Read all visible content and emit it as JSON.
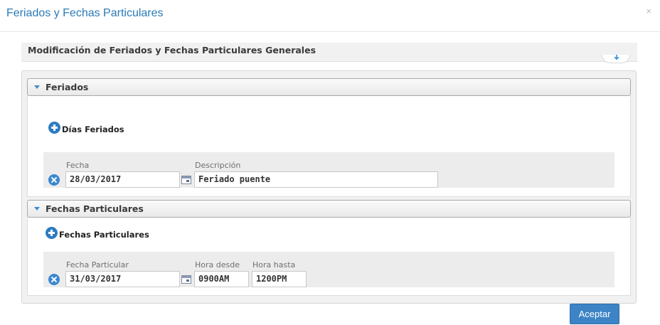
{
  "modal": {
    "title": "Feriados y Fechas Particulares",
    "close_glyph": "×"
  },
  "general": {
    "title": "Modificación de  Feriados y Fechas Particulares Generales"
  },
  "feriados": {
    "section_title": "Feriados",
    "add_label": "Días Feriados",
    "fields": {
      "date_label": "Fecha",
      "description_label": "Descripción"
    },
    "rows": [
      {
        "date": "28/03/2017",
        "description": "Feriado puente"
      }
    ]
  },
  "particulares": {
    "section_title": "Fechas Particulares",
    "add_label": "Fechas Particulares",
    "fields": {
      "date_label": "Fecha Particular",
      "from_label": "Hora desde",
      "to_label": "Hora hasta"
    },
    "rows": [
      {
        "date": "31/03/2017",
        "from": "0900AM",
        "to": "1200PM"
      }
    ]
  },
  "footer": {
    "accept_label": "Aceptar"
  },
  "colors": {
    "title_blue": "#2a7ab8",
    "accent_blue": "#3d84c6",
    "icon_blue": "#2d7bc1"
  },
  "icons": {
    "add": "plus-circle-icon",
    "remove": "remove-circle-icon",
    "calendar": "calendar-icon",
    "collapse": "caret-down-icon",
    "toggle": "arrow-down-icon"
  }
}
